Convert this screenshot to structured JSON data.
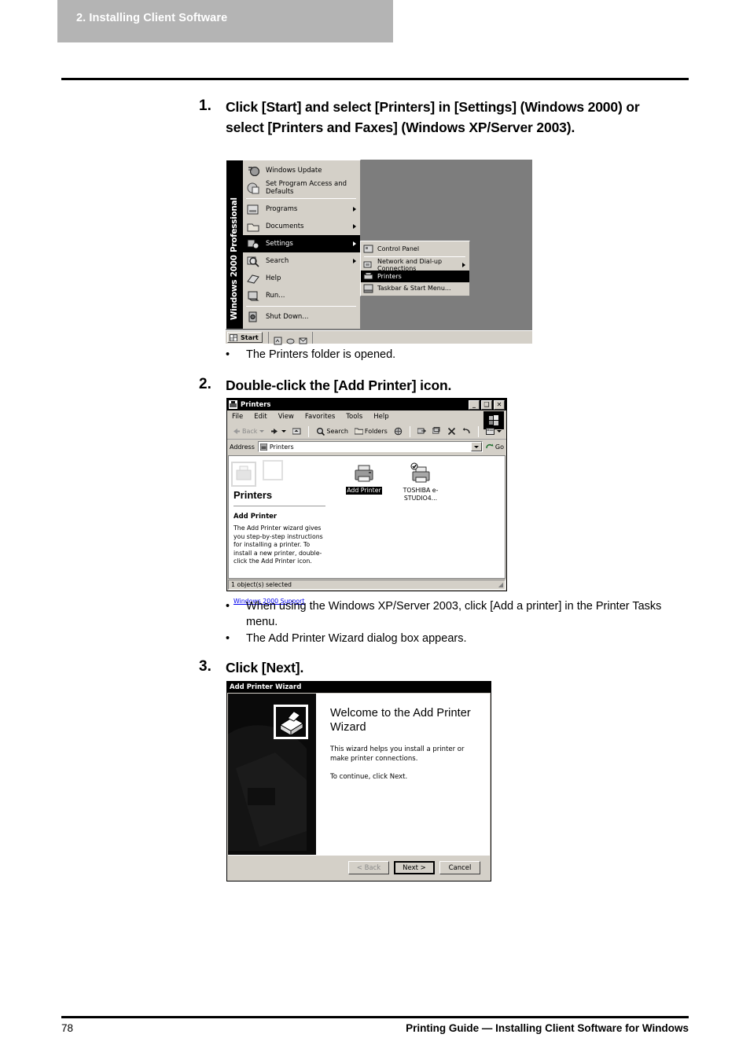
{
  "chapter": {
    "banner_label": "2. Installing Client Software"
  },
  "footer": {
    "page_number": "78",
    "title": "Printing Guide — Installing Client Software for Windows"
  },
  "steps": [
    {
      "number": "1.",
      "text": "Click [Start] and select [Printers] in [Settings] (Windows 2000) or select [Printers and Faxes] (Windows XP/Server 2003)."
    },
    {
      "number": "2.",
      "text": "Double-click the [Add Printer] icon."
    },
    {
      "number": "3.",
      "text": "Click [Next]."
    }
  ],
  "notes_after_step1": [
    {
      "bullet": "•",
      "text": "The Printers folder is opened."
    }
  ],
  "notes_after_step2": [
    {
      "bullet": "•",
      "text": "When using the Windows XP/Server 2003, click [Add a printer] in the Printer Tasks menu."
    },
    {
      "bullet": "•",
      "text": "The Add Printer Wizard dialog box appears."
    }
  ],
  "start_menu": {
    "sidebar_text": "Windows 2000 Professional",
    "items": [
      {
        "label": "Windows Update",
        "icon": "windows-update-icon",
        "arrow": false,
        "selected": false
      },
      {
        "label": "Set Program Access and Defaults",
        "icon": "set-program-access-icon",
        "arrow": false,
        "selected": false
      },
      {
        "label": "Programs",
        "icon": "programs-icon",
        "arrow": true,
        "selected": false
      },
      {
        "label": "Documents",
        "icon": "documents-icon",
        "arrow": true,
        "selected": false
      },
      {
        "label": "Settings",
        "icon": "settings-icon",
        "arrow": true,
        "selected": true
      },
      {
        "label": "Search",
        "icon": "search-icon",
        "arrow": true,
        "selected": false
      },
      {
        "label": "Help",
        "icon": "help-icon",
        "arrow": false,
        "selected": false
      },
      {
        "label": "Run...",
        "icon": "run-icon",
        "arrow": false,
        "selected": false
      },
      {
        "label": "Shut Down...",
        "icon": "shutdown-icon",
        "arrow": false,
        "selected": false
      }
    ],
    "submenu": [
      {
        "label": "Control Panel",
        "icon": "control-panel-icon",
        "arrow": false,
        "selected": false
      },
      {
        "label": "Network and Dial-up Connections",
        "icon": "network-connections-icon",
        "arrow": true,
        "selected": false
      },
      {
        "label": "Printers",
        "icon": "printers-icon",
        "arrow": false,
        "selected": true
      },
      {
        "label": "Taskbar & Start Menu...",
        "icon": "taskbar-startmenu-icon",
        "arrow": false,
        "selected": false
      }
    ],
    "taskbar": {
      "start_label": "Start"
    }
  },
  "printers_window": {
    "title": "Printers",
    "window_buttons": {
      "minimize": "_",
      "maximize": "❑",
      "close": "✕"
    },
    "menus": [
      "File",
      "Edit",
      "View",
      "Favorites",
      "Tools",
      "Help"
    ],
    "toolbar": {
      "back": "Back",
      "forward": "",
      "up": "",
      "search": "Search",
      "folders": "Folders",
      "history": "",
      "move_to": "",
      "copy_to": "",
      "delete": "",
      "undo": "",
      "views": ""
    },
    "address": {
      "label": "Address",
      "value": "Printers",
      "go_label": "Go"
    },
    "folder_name": "Printers",
    "detail_title": "Add Printer",
    "detail_text": "The Add Printer wizard gives you step-by-step instructions for installing a printer. To install a new printer, double-click the Add Printer icon.",
    "support_link": "Windows 2000 Support",
    "icons": [
      {
        "label": "Add Printer",
        "selected": true,
        "icon": "add-printer-icon"
      },
      {
        "label": "TOSHIBA e-STUDIO4...",
        "selected": false,
        "icon": "toshiba-printer-icon"
      }
    ],
    "status": "1 object(s) selected"
  },
  "wizard": {
    "title": "Add Printer Wizard",
    "heading": "Welcome to the Add Printer Wizard",
    "paragraph1": "This wizard helps you install a printer or make printer connections.",
    "paragraph2": "To continue, click Next.",
    "buttons": {
      "back": "< Back",
      "next": "Next >",
      "cancel": "Cancel"
    }
  }
}
